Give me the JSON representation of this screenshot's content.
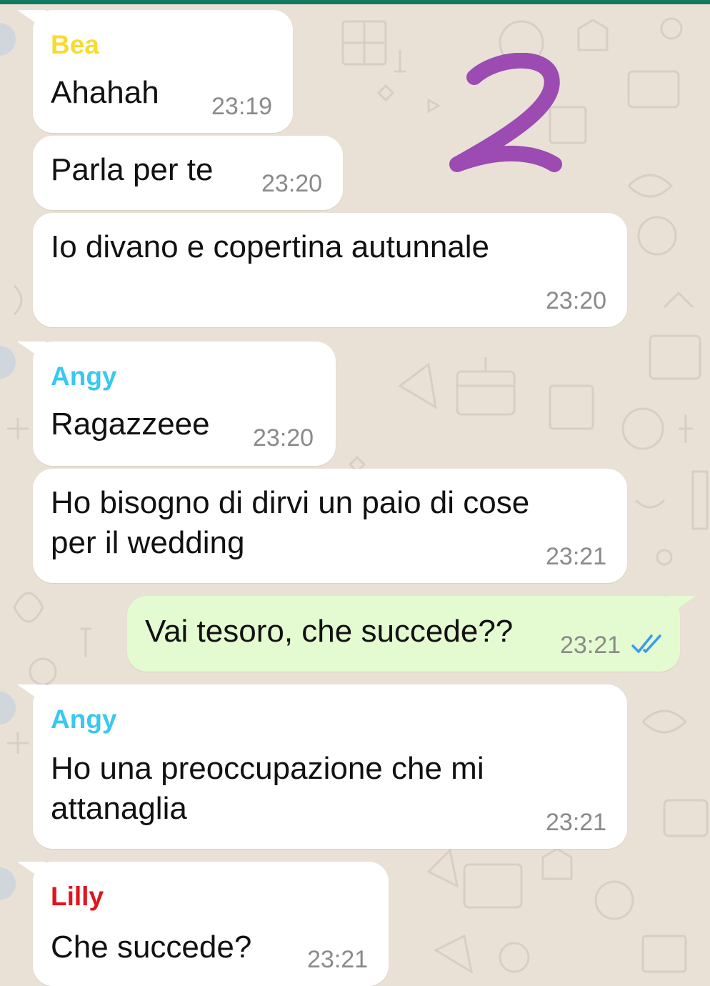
{
  "colors": {
    "wallpaper": "#e9e1d6",
    "incoming_bubble": "#ffffff",
    "outgoing_bubble": "#e4fbd2",
    "sender_bea": "#f7dc2e",
    "sender_angy": "#39c8ef",
    "sender_lilly": "#e0141c",
    "read_ticks": "#3a9be9",
    "annotation": "#9b4bb2"
  },
  "icons": {
    "read_receipt": "double-check-icon",
    "annotation": "handwritten-number-two"
  },
  "messages": [
    {
      "sender": "Bea",
      "text": "Ahahah",
      "time": "23:19"
    },
    {
      "text": "Parla per te",
      "time": "23:20"
    },
    {
      "text": "Io divano e copertina autunnale",
      "time": "23:20"
    },
    {
      "sender": "Angy",
      "text": "Ragazzeee",
      "time": "23:20"
    },
    {
      "text_line1": "Ho bisogno di dirvi un paio di cose",
      "text_line2": "per il wedding",
      "time": "23:21"
    },
    {
      "text": "Vai tesoro, che succede??",
      "time": "23:21",
      "direction": "outgoing",
      "status": "read"
    },
    {
      "sender": "Angy",
      "text_line1": "Ho una preoccupazione che mi",
      "text_line2": "attanaglia",
      "time": "23:21"
    },
    {
      "sender": "Lilly",
      "text": "Che succede?",
      "time": "23:21"
    }
  ]
}
